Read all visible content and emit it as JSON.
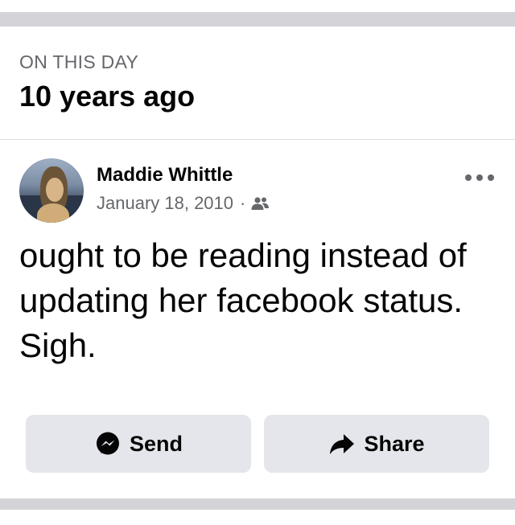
{
  "memory": {
    "label": "ON THIS DAY",
    "title": "10 years ago"
  },
  "post": {
    "author": "Maddie Whittle",
    "date": "January 18, 2010",
    "separator": "·",
    "audience_icon": "friends-icon",
    "more_icon": "more-options-icon",
    "text": "ought to be reading instead of updating her facebook status. Sigh."
  },
  "actions": {
    "send_label": "Send",
    "send_icon": "messenger-icon",
    "share_label": "Share",
    "share_icon": "share-arrow-icon"
  },
  "colors": {
    "secondary_text": "#65676b",
    "button_bg": "#e4e6eb",
    "band": "#d4d4d8"
  }
}
